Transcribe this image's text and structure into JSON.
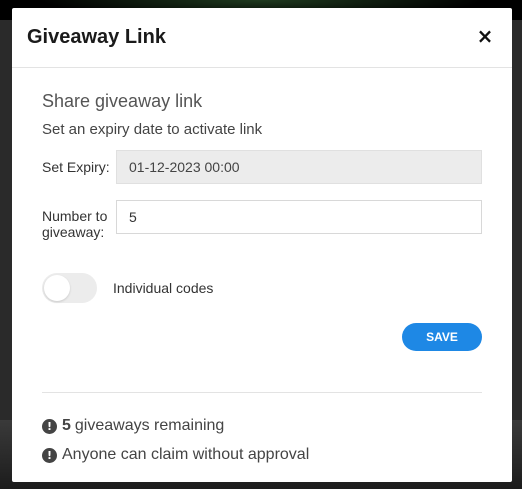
{
  "modal": {
    "title": "Giveaway Link",
    "close_icon": "×"
  },
  "share": {
    "heading": "Share giveaway link",
    "subheading": "Set an expiry date to activate link"
  },
  "form": {
    "expiry_label": "Set Expiry:",
    "expiry_value": "01-12-2023 00:00",
    "number_label": "Number to giveaway:",
    "number_value": "5",
    "toggle_label": "Individual codes",
    "toggle_on": false
  },
  "actions": {
    "save_label": "SAVE"
  },
  "info": {
    "icon": "exclamation-circle-icon",
    "remaining_count": "5",
    "remaining_text": "giveaways remaining",
    "approval_text": "Anyone can claim without approval"
  },
  "colors": {
    "accent": "#1e88e5",
    "disabled_field": "#ececec"
  }
}
